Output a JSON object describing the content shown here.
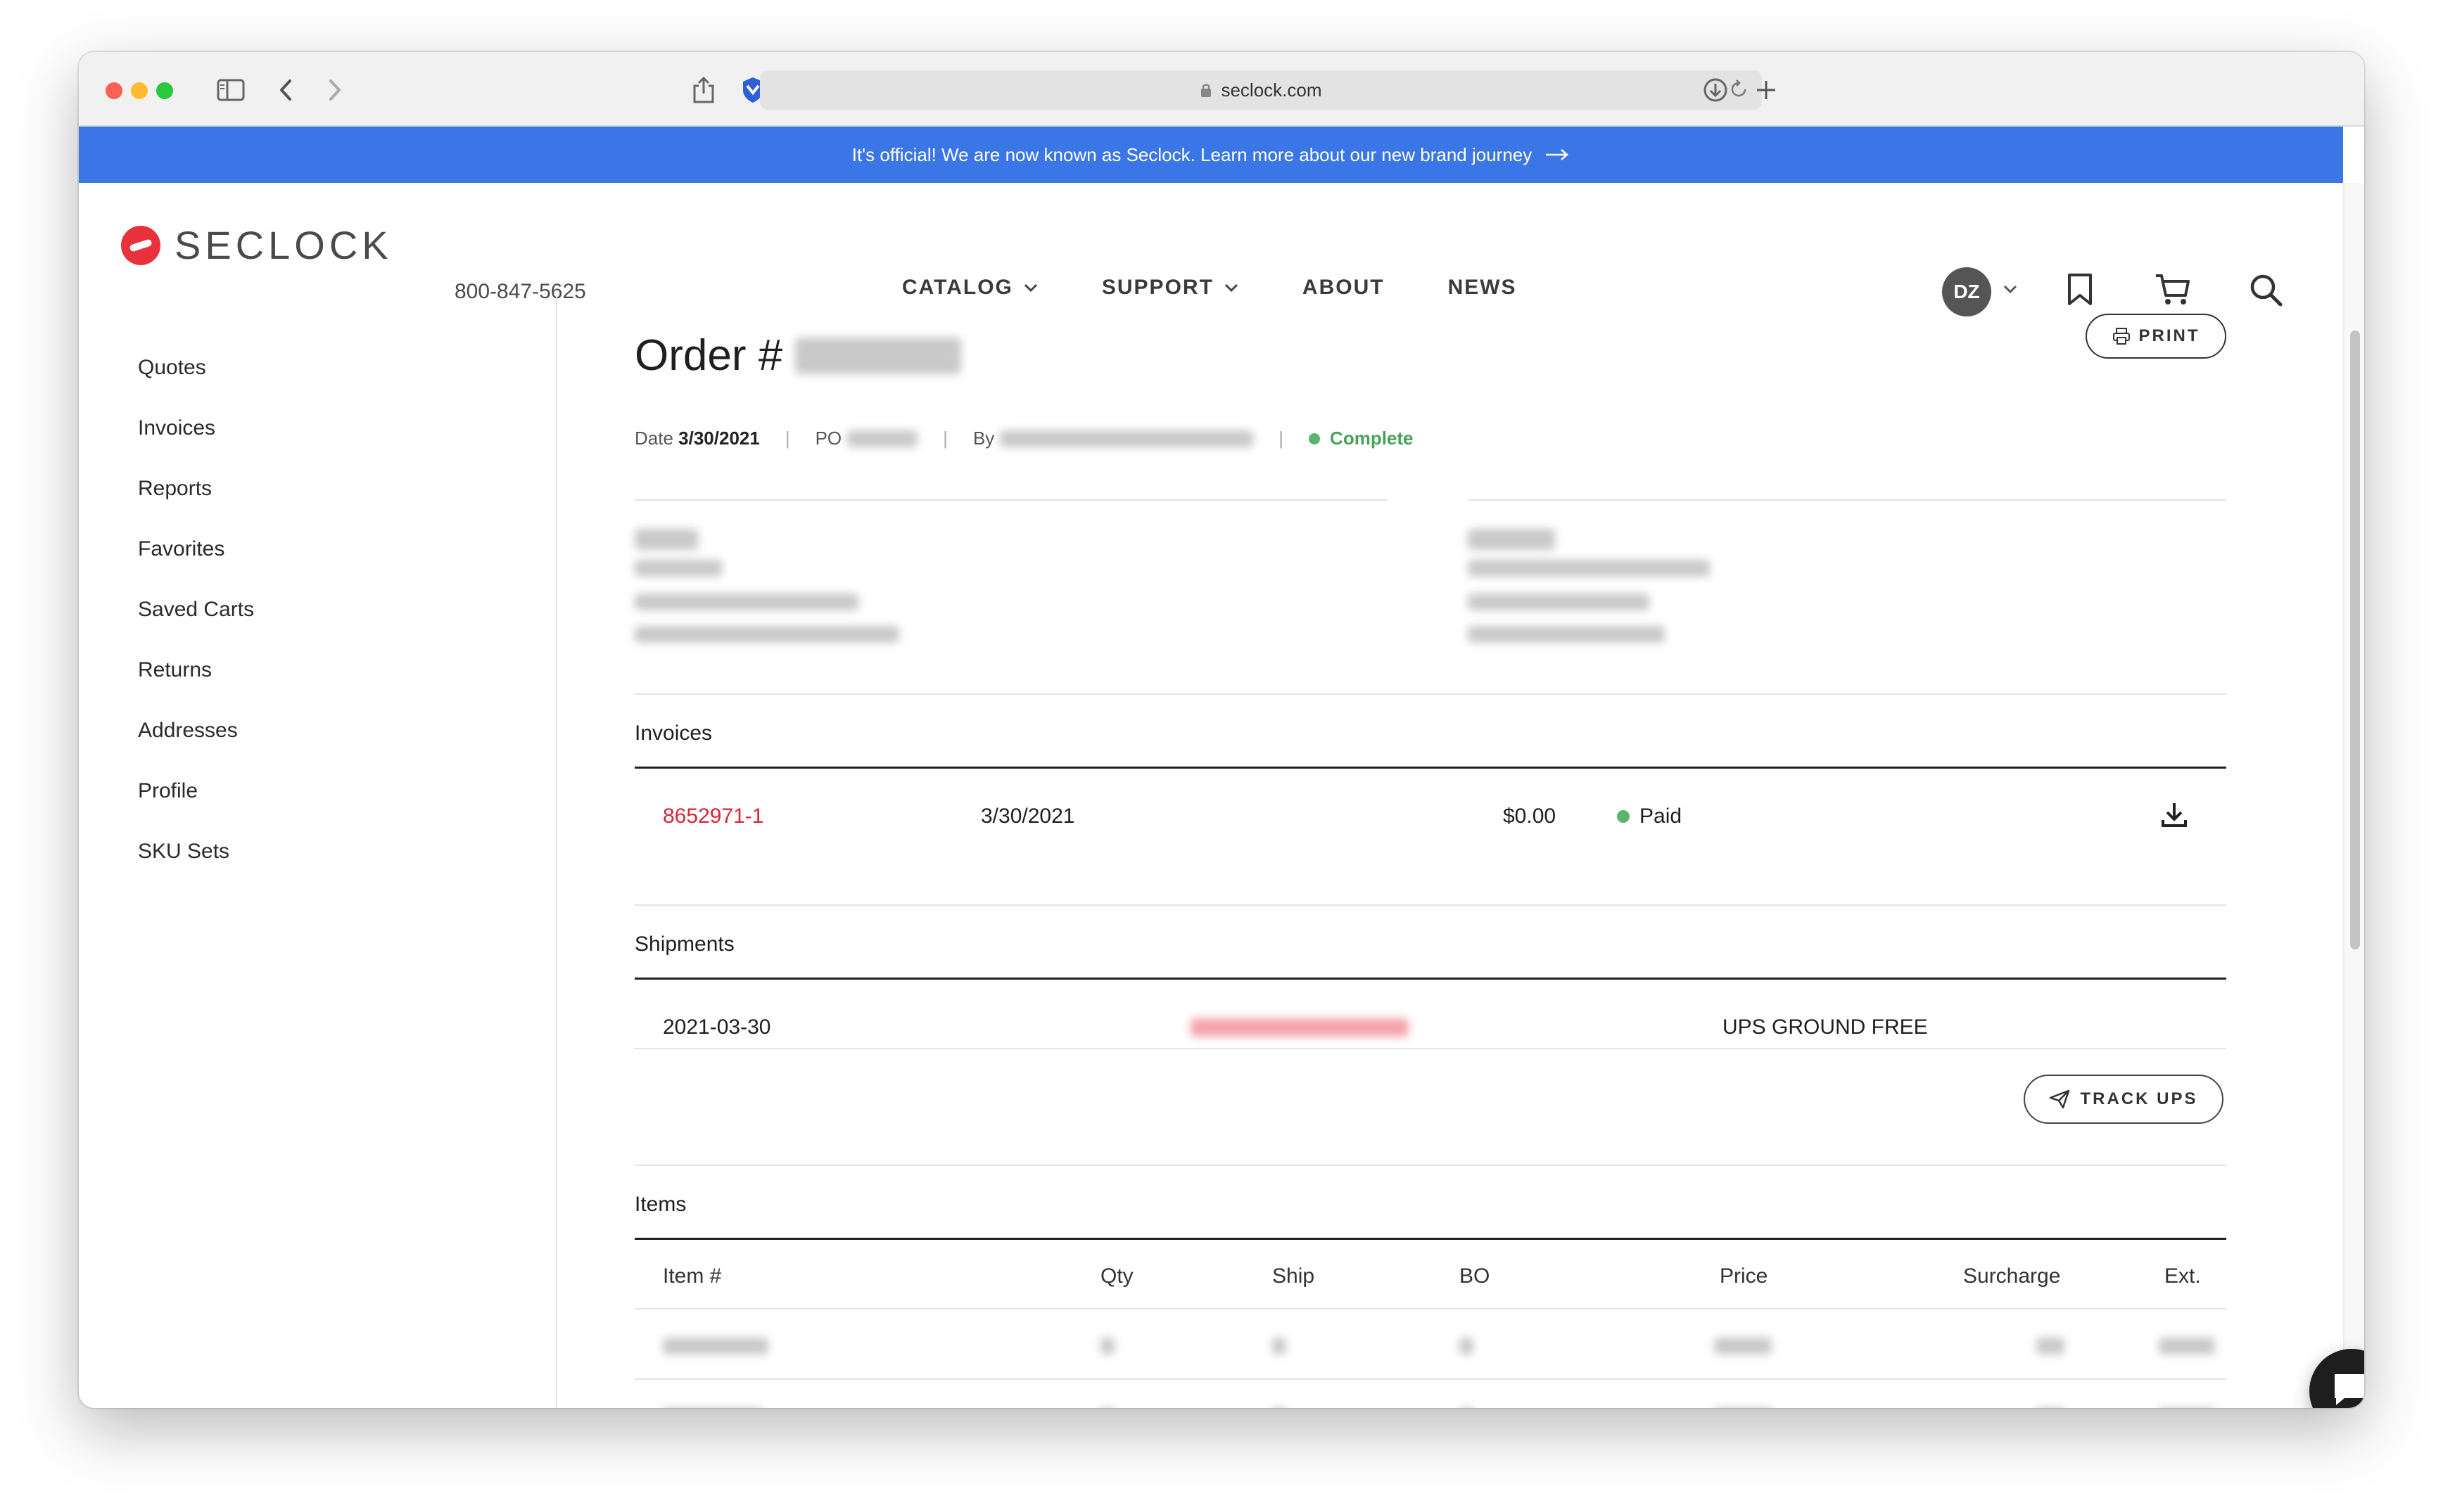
{
  "browser": {
    "url": "seclock.com"
  },
  "announcement": {
    "text": "It's official! We are now known as Seclock. Learn more about our new brand journey"
  },
  "header": {
    "brand": "SECLOCK",
    "phone": "800-847-5625",
    "nav": [
      "CATALOG",
      "SUPPORT",
      "ABOUT",
      "NEWS"
    ],
    "avatar_initials": "DZ"
  },
  "sidebar": {
    "items": [
      "Quotes",
      "Invoices",
      "Reports",
      "Favorites",
      "Saved Carts",
      "Returns",
      "Addresses",
      "Profile",
      "SKU Sets"
    ]
  },
  "order": {
    "title_prefix": "Order #",
    "date_label": "Date",
    "date": "3/30/2021",
    "po_label": "PO",
    "by_label": "By",
    "status": "Complete",
    "print_label": "PRINT"
  },
  "invoices": {
    "title": "Invoices",
    "rows": [
      {
        "number": "8652971-1",
        "date": "3/30/2021",
        "amount": "$0.00",
        "status": "Paid"
      }
    ]
  },
  "shipments": {
    "title": "Shipments",
    "rows": [
      {
        "date": "2021-03-30",
        "method": "UPS GROUND FREE"
      }
    ],
    "track_label": "TRACK UPS"
  },
  "items": {
    "title": "Items",
    "columns": [
      "Item #",
      "Qty",
      "Ship",
      "BO",
      "Price",
      "Surcharge",
      "Ext."
    ]
  },
  "colors": {
    "accent_blue": "#3b76e6",
    "brand_red": "#e8313b",
    "status_green": "#5ab46a",
    "link_red": "#d9253a"
  }
}
